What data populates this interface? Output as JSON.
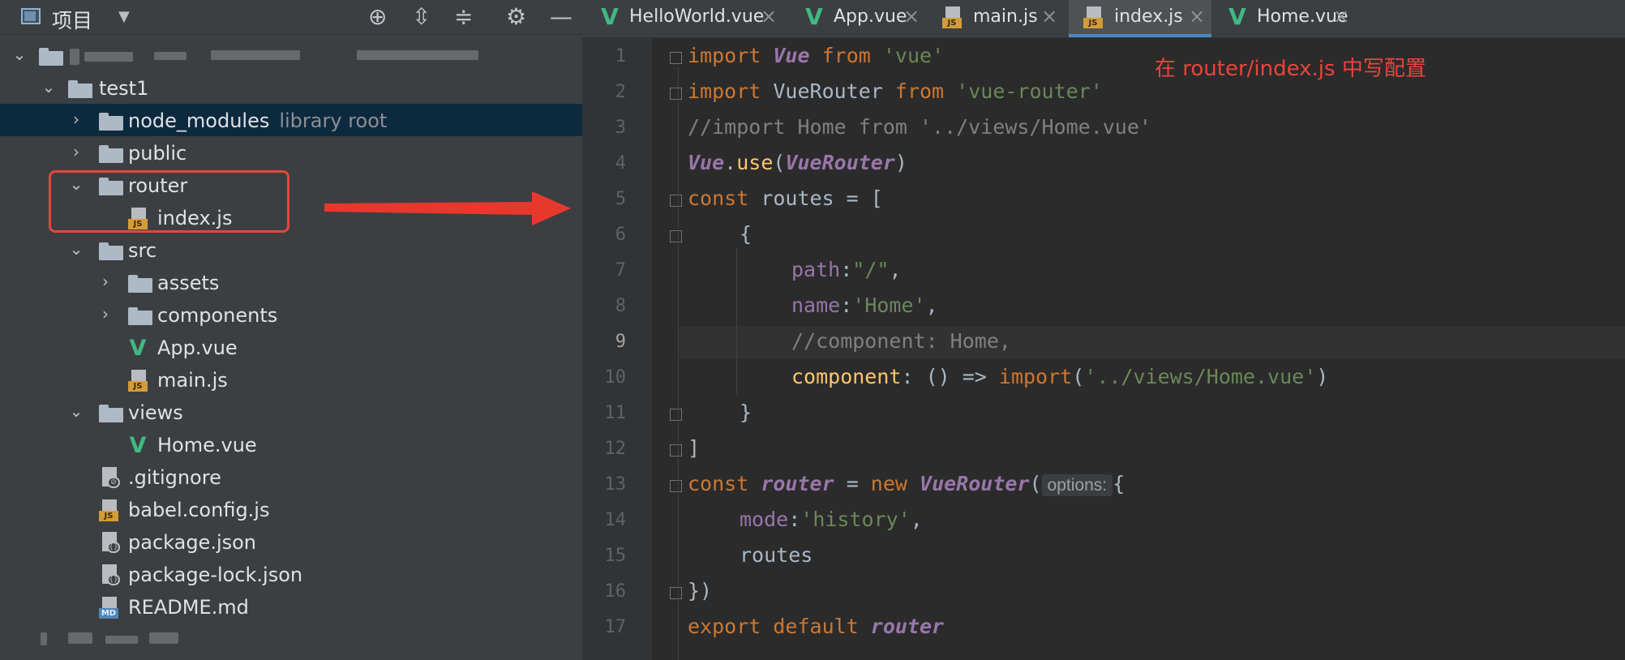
{
  "project_panel": {
    "title": "项目",
    "toolbar_icons": [
      "locate-icon",
      "expand-all-icon",
      "collapse-all-icon",
      "gear-icon",
      "minimize-icon"
    ],
    "tree": [
      {
        "label": "test1"
      },
      {
        "label": "node_modules",
        "hint": "library root"
      },
      {
        "label": "public"
      },
      {
        "label": "router"
      },
      {
        "label": "index.js"
      },
      {
        "label": "src"
      },
      {
        "label": "assets"
      },
      {
        "label": "components"
      },
      {
        "label": "App.vue"
      },
      {
        "label": "main.js"
      },
      {
        "label": "views"
      },
      {
        "label": "Home.vue"
      },
      {
        "label": ".gitignore"
      },
      {
        "label": "babel.config.js"
      },
      {
        "label": "package.json"
      },
      {
        "label": "package-lock.json"
      },
      {
        "label": "README.md"
      }
    ]
  },
  "tabs": [
    {
      "label": "HelloWorld.vue",
      "type": "vue"
    },
    {
      "label": "App.vue",
      "type": "vue"
    },
    {
      "label": "main.js",
      "type": "js"
    },
    {
      "label": "index.js",
      "type": "js",
      "active": true
    },
    {
      "label": "Home.vue",
      "type": "vue"
    }
  ],
  "editor": {
    "current_line": 9,
    "line_numbers": [
      "1",
      "2",
      "3",
      "4",
      "5",
      "6",
      "7",
      "8",
      "9",
      "10",
      "11",
      "12",
      "13",
      "14",
      "15",
      "16",
      "17"
    ],
    "code": {
      "l1": {
        "a": "import",
        "b": " ",
        "c": "Vue",
        "d": " ",
        "e": "from",
        "f": " ",
        "g": "'vue'"
      },
      "l2": {
        "a": "import",
        "b": " VueRouter ",
        "c": "from",
        "d": " ",
        "e": "'vue-router'"
      },
      "l3": "//import Home from '../views/Home.vue'",
      "l4": {
        "a": "Vue",
        "b": ".",
        "c": "use",
        "d": "(",
        "e": "VueRouter",
        "f": ")"
      },
      "l5": {
        "a": "const",
        "b": " routes = ["
      },
      "l6": "{",
      "l7": {
        "a": "path",
        "b": ":",
        "c": "\"/\"",
        "d": ","
      },
      "l8": {
        "a": "name",
        "b": ":",
        "c": "'Home'",
        "d": ","
      },
      "l9": "//component: Home,",
      "l10": {
        "a": "component",
        "b": ": () => ",
        "c": "import",
        "d": "(",
        "e": "'../views/Home.vue'",
        "f": ")"
      },
      "l11": "}",
      "l12": "]",
      "l13": {
        "a": "const",
        "b": " ",
        "c": "router",
        "d": " = ",
        "e": "new",
        "f": " ",
        "g": "VueRouter",
        "h": "(",
        "hint": "options:",
        "i": "{"
      },
      "l14": {
        "a": "mode",
        "b": ":",
        "c": "'history'",
        "d": ","
      },
      "l15": "routes",
      "l16": "})",
      "l17": {
        "a": "export",
        "b": " ",
        "c": "default",
        "d": " ",
        "e": "router"
      }
    }
  },
  "annotation": "在 router/index.js 中写配置",
  "colors": {
    "annotation": "#e8453c",
    "active_tab_underline": "#4a88c7",
    "vue_green": "#41b883"
  }
}
